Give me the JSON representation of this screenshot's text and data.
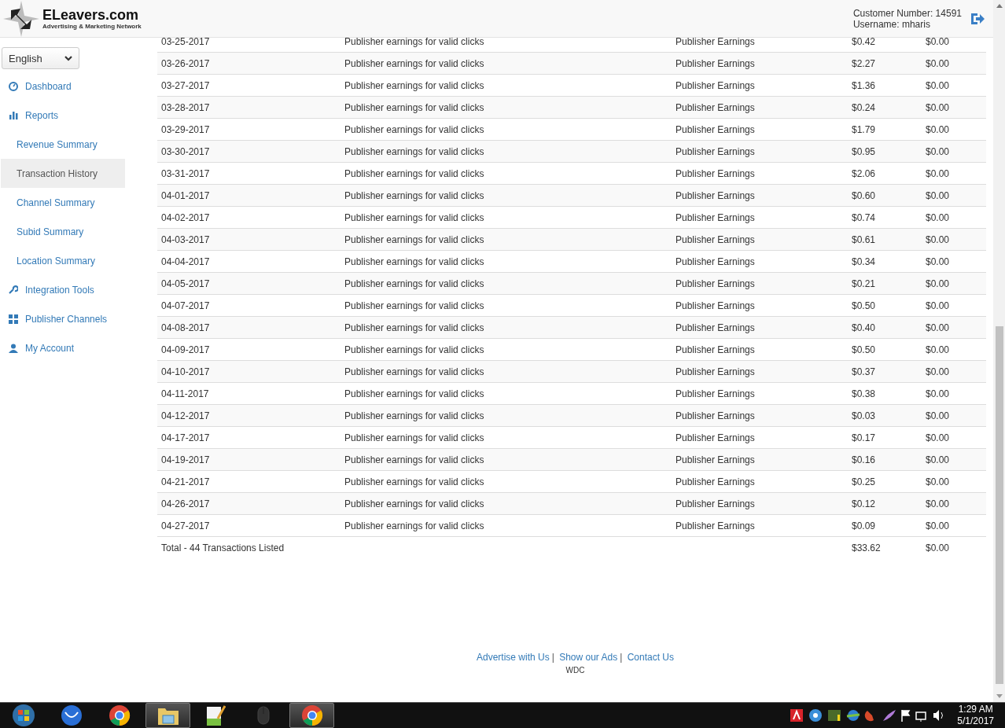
{
  "header": {
    "logo_title": "ELeavers.com",
    "logo_tagline": "Advertising & Marketing Network",
    "customer_number": "Customer Number: 14591",
    "username": "Username: mharis"
  },
  "sidebar": {
    "language": "English",
    "items": [
      {
        "label": "Dashboard",
        "kind": "section",
        "selected": false
      },
      {
        "label": "Reports",
        "kind": "section",
        "selected": false
      },
      {
        "label": "Revenue Summary",
        "kind": "sub",
        "selected": false
      },
      {
        "label": "Transaction History",
        "kind": "sub",
        "selected": true
      },
      {
        "label": "Channel Summary",
        "kind": "sub",
        "selected": false
      },
      {
        "label": "Subid Summary",
        "kind": "sub",
        "selected": false
      },
      {
        "label": "Location Summary",
        "kind": "sub",
        "selected": false
      },
      {
        "label": "Integration Tools",
        "kind": "section",
        "selected": false
      },
      {
        "label": "Publisher Channels",
        "kind": "section",
        "selected": false
      },
      {
        "label": "My Account",
        "kind": "section",
        "selected": false
      }
    ]
  },
  "table": {
    "rows": [
      [
        "03-25-2017",
        "Publisher earnings for valid clicks",
        "Publisher Earnings",
        "$0.42",
        "$0.00"
      ],
      [
        "03-26-2017",
        "Publisher earnings for valid clicks",
        "Publisher Earnings",
        "$2.27",
        "$0.00"
      ],
      [
        "03-27-2017",
        "Publisher earnings for valid clicks",
        "Publisher Earnings",
        "$1.36",
        "$0.00"
      ],
      [
        "03-28-2017",
        "Publisher earnings for valid clicks",
        "Publisher Earnings",
        "$0.24",
        "$0.00"
      ],
      [
        "03-29-2017",
        "Publisher earnings for valid clicks",
        "Publisher Earnings",
        "$1.79",
        "$0.00"
      ],
      [
        "03-30-2017",
        "Publisher earnings for valid clicks",
        "Publisher Earnings",
        "$0.95",
        "$0.00"
      ],
      [
        "03-31-2017",
        "Publisher earnings for valid clicks",
        "Publisher Earnings",
        "$2.06",
        "$0.00"
      ],
      [
        "04-01-2017",
        "Publisher earnings for valid clicks",
        "Publisher Earnings",
        "$0.60",
        "$0.00"
      ],
      [
        "04-02-2017",
        "Publisher earnings for valid clicks",
        "Publisher Earnings",
        "$0.74",
        "$0.00"
      ],
      [
        "04-03-2017",
        "Publisher earnings for valid clicks",
        "Publisher Earnings",
        "$0.61",
        "$0.00"
      ],
      [
        "04-04-2017",
        "Publisher earnings for valid clicks",
        "Publisher Earnings",
        "$0.34",
        "$0.00"
      ],
      [
        "04-05-2017",
        "Publisher earnings for valid clicks",
        "Publisher Earnings",
        "$0.21",
        "$0.00"
      ],
      [
        "04-07-2017",
        "Publisher earnings for valid clicks",
        "Publisher Earnings",
        "$0.50",
        "$0.00"
      ],
      [
        "04-08-2017",
        "Publisher earnings for valid clicks",
        "Publisher Earnings",
        "$0.40",
        "$0.00"
      ],
      [
        "04-09-2017",
        "Publisher earnings for valid clicks",
        "Publisher Earnings",
        "$0.50",
        "$0.00"
      ],
      [
        "04-10-2017",
        "Publisher earnings for valid clicks",
        "Publisher Earnings",
        "$0.37",
        "$0.00"
      ],
      [
        "04-11-2017",
        "Publisher earnings for valid clicks",
        "Publisher Earnings",
        "$0.38",
        "$0.00"
      ],
      [
        "04-12-2017",
        "Publisher earnings for valid clicks",
        "Publisher Earnings",
        "$0.03",
        "$0.00"
      ],
      [
        "04-17-2017",
        "Publisher earnings for valid clicks",
        "Publisher Earnings",
        "$0.17",
        "$0.00"
      ],
      [
        "04-19-2017",
        "Publisher earnings for valid clicks",
        "Publisher Earnings",
        "$0.16",
        "$0.00"
      ],
      [
        "04-21-2017",
        "Publisher earnings for valid clicks",
        "Publisher Earnings",
        "$0.25",
        "$0.00"
      ],
      [
        "04-26-2017",
        "Publisher earnings for valid clicks",
        "Publisher Earnings",
        "$0.12",
        "$0.00"
      ],
      [
        "04-27-2017",
        "Publisher earnings for valid clicks",
        "Publisher Earnings",
        "$0.09",
        "$0.00"
      ]
    ],
    "total": {
      "label": "Total - 44 Transactions Listed",
      "amount": "$33.62",
      "amount_2": "$0.00"
    }
  },
  "footer": {
    "links": [
      "Advertise with Us",
      "Show our Ads",
      "Contact Us"
    ],
    "separator": "|",
    "note": "WDC"
  },
  "taskbar": {
    "apps": [
      {
        "active": false
      },
      {
        "active": false
      },
      {
        "active": false
      },
      {
        "active": true
      },
      {
        "active": false
      },
      {
        "active": false
      },
      {
        "active": true
      }
    ],
    "time": "1:29 AM",
    "date": "5/1/2017"
  }
}
